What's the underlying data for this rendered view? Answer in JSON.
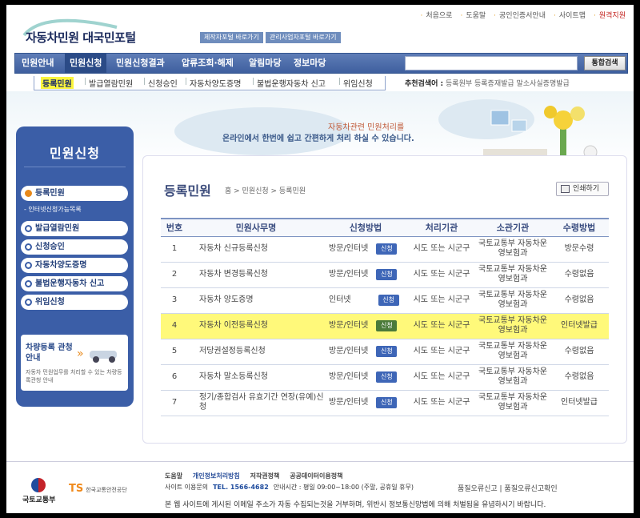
{
  "header": {
    "logo_text": "자동차민원 대국민포털",
    "quick_links": [
      "제작자포털 바로가기",
      "관리사업자포털 바로가기"
    ],
    "util_links": [
      "처음으로",
      "도움말",
      "공인인증서안내",
      "사이트맵",
      "원격지원"
    ]
  },
  "gnb": {
    "items": [
      "민원안내",
      "민원신청",
      "민원신청결과",
      "압류조회·해제",
      "알림마당",
      "정보마당"
    ],
    "search_button": "통합검색"
  },
  "lnb": {
    "items": [
      "등록민원",
      "발급열람민원",
      "신청승인",
      "자동차양도증명",
      "불법운행자동차 신고",
      "위임신청"
    ]
  },
  "recommended": {
    "label": "추천검색어 :",
    "terms": "등록원부  등록증재발급  말소사실증명발급"
  },
  "banner": {
    "line1": "자동차관련 민원처리를",
    "line2": "온라인에서 한번에 쉽고 간편하게 처리 하실 수 있습니다."
  },
  "sidebar": {
    "title": "민원신청",
    "items": [
      "등록민원",
      "발급열람민원",
      "신청승인",
      "자동차양도증명",
      "불법운행자동차 신고",
      "위임신청"
    ],
    "sub_item": "- 인터넷신청가능목록",
    "guide_title": "차량등록 관청 안내",
    "guide_desc": "자동차 민원업무를 처리할 수 있는 차량등록관청 안내"
  },
  "content": {
    "title": "등록민원",
    "breadcrumb": "홈 > 민원신청 > 등록민원",
    "print_label": "인쇄하기",
    "columns": [
      "번호",
      "민원사무명",
      "신청방법",
      "처리기관",
      "소관기관",
      "수령방법"
    ],
    "apply_label": "신청",
    "rows": [
      {
        "no": "1",
        "name": "자동차 신규등록신청",
        "method": "방문/인터넷",
        "org": "시도 또는 시군구",
        "owner": "국토교통부 자동차운영보험과",
        "receive": "방문수령"
      },
      {
        "no": "2",
        "name": "자동차 변경등록신청",
        "method": "방문/인터넷",
        "org": "시도 또는 시군구",
        "owner": "국토교통부 자동차운영보험과",
        "receive": "수령없음"
      },
      {
        "no": "3",
        "name": "자동차 양도증명",
        "method": "인터넷",
        "org": "시도 또는 시군구",
        "owner": "국토교통부 자동차운영보험과",
        "receive": "수령없음"
      },
      {
        "no": "4",
        "name": "자동차 이전등록신청",
        "method": "방문/인터넷",
        "org": "시도 또는 시군구",
        "owner": "국토교통부 자동차운영보험과",
        "receive": "인터넷발급"
      },
      {
        "no": "5",
        "name": "저당권설정등록신청",
        "method": "방문/인터넷",
        "org": "시도 또는 시군구",
        "owner": "국토교통부 자동차운영보험과",
        "receive": "수령없음"
      },
      {
        "no": "6",
        "name": "자동차 말소등록신청",
        "method": "방문/인터넷",
        "org": "시도 또는 시군구",
        "owner": "국토교통부 자동차운영보험과",
        "receive": "수령없음"
      },
      {
        "no": "7",
        "name": "정기/종합검사 유효기간 연장(유예)신청",
        "method": "방문/인터넷",
        "org": "시도 또는 시군구",
        "owner": "국토교통부 자동차운영보험과",
        "receive": "인터넷발급"
      }
    ]
  },
  "footer": {
    "logo1": "국토교통부",
    "logo2": "TS",
    "logo2_sub": "한국교통안전공단",
    "links": [
      "도움말",
      "개인정보처리방침",
      "저작권정책",
      "공공데이터이용정책"
    ],
    "info_prefix": "사이트 이용문의",
    "tel": "TEL. 1566-4682",
    "hours": "안내시간 : 평일 09:00~18:00 (주말, 공휴일 휴무)",
    "right": "품질오류신고 | 품질오류신고확인",
    "note": "본 웹 사이트에 게시된 이메일 주소가 자동 수집되는것을 거부하며, 위반시 정보통신망법에 의해 처벌됨을 유념하시기 바랍니다."
  },
  "colors": {
    "nav": "#3e5f9f",
    "highlight": "#fff97a",
    "badge": "#3e66b7"
  }
}
